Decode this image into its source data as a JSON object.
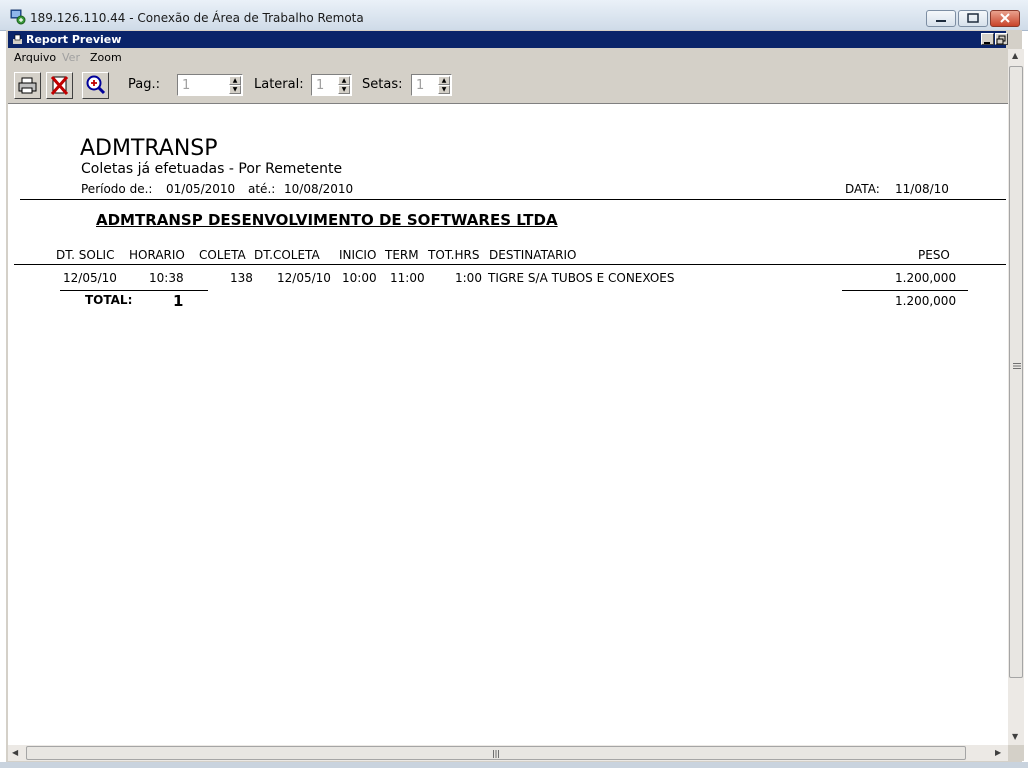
{
  "rdp_window": {
    "title": "189.126.110.44 - Conexão de Área de Trabalho Remota"
  },
  "report_window": {
    "title": "Report Preview"
  },
  "menu": {
    "items": [
      "Arquivo",
      "Ver",
      "Zoom"
    ],
    "disabled": [
      "Ver"
    ]
  },
  "toolbar": {
    "print_icon": "printer-icon",
    "close_icon": "close-report-icon",
    "zoom_icon": "zoom-in-icon",
    "pag_label": "Pag.:",
    "pag_value": "1",
    "lateral_label": "Lateral:",
    "lateral_value": "1",
    "setas_label": "Setas:",
    "setas_value": "1"
  },
  "report": {
    "company": "ADMTRANSP",
    "subtitle": "Coletas já efetuadas - Por Remetente",
    "periodo_label": "Período de.:",
    "periodo_start": "01/05/2010",
    "ate_label": "até.:",
    "periodo_end": "10/08/2010",
    "data_label": "DATA:",
    "data_value": "11/08/10",
    "sender": "ADMTRANSP DESENVOLVIMENTO DE SOFTWARES LTDA",
    "columns": [
      "DT. SOLIC",
      "HORARIO",
      "COLETA",
      "DT.COLETA",
      "INICIO",
      "TERM",
      "TOT.HRS",
      "DESTINATARIO",
      "PESO"
    ],
    "rows": [
      {
        "dt_solic": "12/05/10",
        "horario": "10:38",
        "coleta": "138",
        "dt_coleta": "12/05/10",
        "inicio": "10:00",
        "term": "11:00",
        "tot_hrs": "1:00",
        "destinatario": "TIGRE S/A TUBOS E CONEXOES",
        "peso": "1.200,000"
      }
    ],
    "total_label": "TOTAL:",
    "total_count": "1",
    "total_peso": "1.200,000"
  },
  "colors": {
    "report_titlebar": "#0a246a",
    "window_face": "#d4d0c8"
  }
}
